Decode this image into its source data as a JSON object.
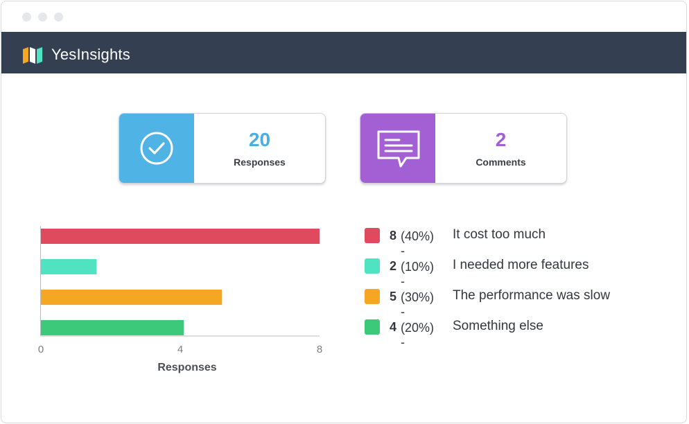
{
  "app": {
    "brand": "YesInsights"
  },
  "stats": [
    {
      "value": "20",
      "label": "Responses",
      "color": "#4fb3e6",
      "icon": "check-circle-icon"
    },
    {
      "value": "2",
      "label": "Comments",
      "color": "#a35fd4",
      "icon": "comment-bubble-icon"
    }
  ],
  "legend": [
    {
      "count": "8",
      "pct": "(40%) -",
      "text": "It cost too much",
      "color": "#e04a5f"
    },
    {
      "count": "2",
      "pct": "(10%) -",
      "text": "I needed more features",
      "color": "#4fe3c2"
    },
    {
      "count": "5",
      "pct": "(30%) -",
      "text": "The performance was slow",
      "color": "#f5a623"
    },
    {
      "count": "4",
      "pct": "(20%) -",
      "text": "Something else",
      "color": "#3cc97a"
    }
  ],
  "chart_data": {
    "type": "bar",
    "orientation": "horizontal",
    "categories": [
      "It cost too much",
      "I needed more features",
      "The performance was slow",
      "Something else"
    ],
    "values": [
      8,
      1.6,
      5.2,
      4.1
    ],
    "colors": [
      "#e04a5f",
      "#4fe3c2",
      "#f5a623",
      "#3cc97a"
    ],
    "xlabel": "Responses",
    "xlim": [
      0,
      8
    ],
    "xticks": [
      "0",
      "4",
      "8"
    ],
    "grid": false
  }
}
